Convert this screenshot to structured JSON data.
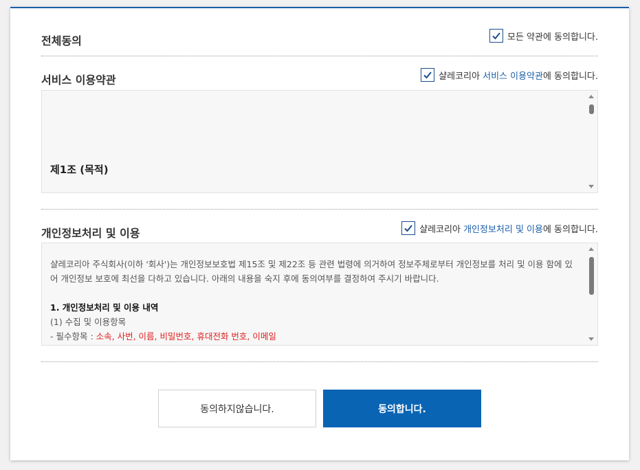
{
  "all_agree": {
    "title": "전체동의",
    "label": "모든 약관에 동의합니다.",
    "checked": true
  },
  "service_terms": {
    "title": "서비스 이용약관",
    "label_prefix": "샬레코리아 ",
    "label_highlight": "서비스 이용약관",
    "label_suffix": "에 동의합니다.",
    "checked": true,
    "article_title": "제1조 (목적)"
  },
  "privacy": {
    "title": "개인정보처리 및 이용",
    "label_prefix": "샬레코리아 ",
    "label_highlight": "개인정보처리 및 이용",
    "label_suffix": "에 동의합니다.",
    "checked": true,
    "intro": "샬레코리아 주식회사(이하 '회사')는 개인정보보호법 제15조 및 제22조 등 관련 법령에 의거하여 정보주체로부터 개인정보를 처리 및 이용 함에 있어 개인정보 보호에 최선을 다하고 있습니다. 아래의 내용을 숙지 후에 동의여부를 결정하여 주시기 바랍니다.",
    "heading": "1. 개인정보처리 및 이용 내역",
    "sub_heading": "(1) 수집 및 이용항목",
    "required_label": "- 필수항목 : ",
    "required_items": "소속, 사번, 이름, 비밀번호, 휴대전화 번호, 이메일"
  },
  "buttons": {
    "disagree": "동의하지않습니다.",
    "agree": "동의합니다."
  },
  "colors": {
    "accent": "#0a64b4",
    "highlight": "#1a5fa8",
    "required": "#e02020"
  },
  "icons": {
    "checkbox": "checkmark-icon",
    "scroll_up": "scroll-up-arrow-icon",
    "scroll_down": "scroll-down-arrow-icon"
  }
}
